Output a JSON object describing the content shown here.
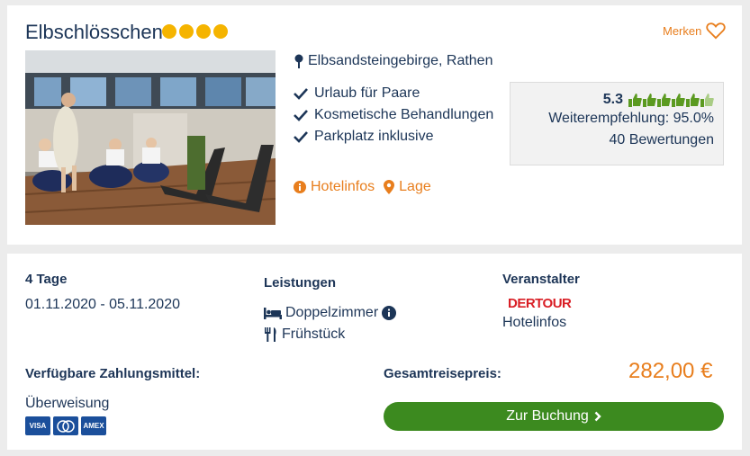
{
  "hotel": {
    "name": "Elbschlösschen",
    "star_count": 4,
    "star_color": "#f5b400",
    "location": "Elbsandsteingebirge, Rathen",
    "features": [
      "Urlaub für Paare",
      "Kosmetische Behandlungen",
      "Parkplatz inklusive"
    ],
    "merken_label": "Merken",
    "links": [
      "Hotelinfos",
      "Lage"
    ]
  },
  "rating": {
    "score": "5.3",
    "thumbs_full": 5,
    "thumbs_half": 1,
    "recommendation": "Weiterempfehlung: 95.0%",
    "reviews": "40 Bewertungen"
  },
  "trip": {
    "duration": "4 Tage",
    "dates": "01.11.2020 - 05.11.2020"
  },
  "services": {
    "heading": "Leistungen",
    "room": "Doppelzimmer",
    "board": "Frühstück"
  },
  "operator": {
    "heading": "Veranstalter",
    "logo_text": "DERTOUR",
    "link": "Hotelinfos"
  },
  "payment": {
    "heading": "Verfügbare Zahlungsmittel:",
    "method": "Überweisung",
    "card_icons": [
      "visa-icon",
      "mastercard-icon",
      "amex-icon"
    ],
    "card_labels": [
      "VISA",
      "MC",
      "AMEX"
    ]
  },
  "price": {
    "label": "Gesamtreisepreis:",
    "amount": "282,00 €"
  },
  "booking": {
    "button_label": "Zur Buchung"
  },
  "colors": {
    "accent": "#e87e1d",
    "primary_text": "#1c3557",
    "button": "#3c8a1f",
    "thumb": "#5b9a20"
  }
}
